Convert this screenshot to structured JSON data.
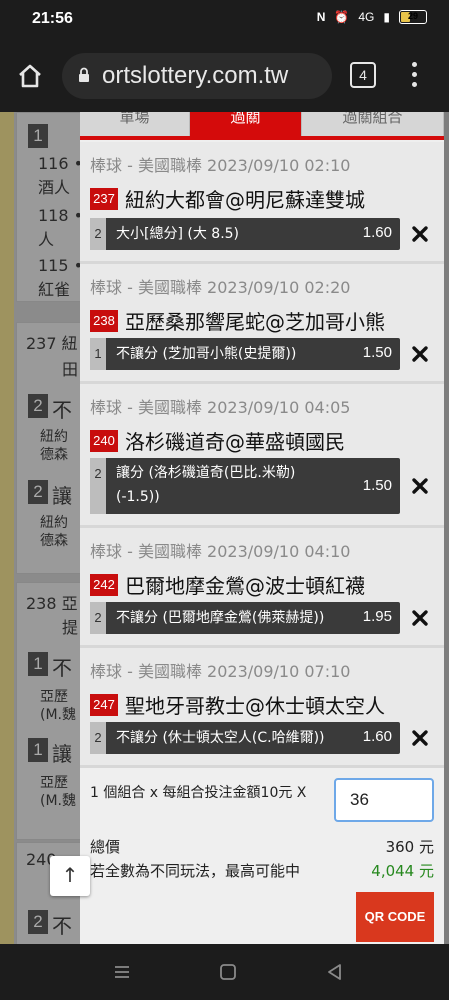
{
  "status": {
    "time": "21:56",
    "network": "4G",
    "battery": "29"
  },
  "browser": {
    "url": "ortslottery.com.tw",
    "tab_count": "4"
  },
  "slip": {
    "tabs": [
      {
        "label": "單場"
      },
      {
        "label": "過關"
      },
      {
        "label": "過關組合"
      }
    ],
    "bets": [
      {
        "league": "棒球 - 美國職棒 2023/09/10 02:10",
        "game_id": "237",
        "match": "紐約大都會@明尼蘇達雙城",
        "count": "2",
        "desc_line1": "大小[總分] (大 8.5)",
        "desc_line2": "",
        "odds": "1.60"
      },
      {
        "league": "棒球 - 美國職棒 2023/09/10 02:20",
        "game_id": "238",
        "match": "亞歷桑那響尾蛇@芝加哥小熊",
        "count": "1",
        "desc_line1": "不讓分 (芝加哥小熊(史提爾))",
        "desc_line2": "",
        "odds": "1.50"
      },
      {
        "league": "棒球 - 美國職棒 2023/09/10 04:05",
        "game_id": "240",
        "match": "洛杉磯道奇@華盛頓國民",
        "count": "2",
        "desc_line1": "讓分 (洛杉磯道奇(巴比.米勒)",
        "desc_line2": "(-1.5))",
        "odds": "1.50"
      },
      {
        "league": "棒球 - 美國職棒 2023/09/10 04:10",
        "game_id": "242",
        "match": "巴爾地摩金鶯@波士頓紅襪",
        "count": "2",
        "desc_line1": "不讓分 (巴爾地摩金鶯(佛萊赫提))",
        "desc_line2": "",
        "odds": "1.95"
      },
      {
        "league": "棒球 - 美國職棒 2023/09/10 07:10",
        "game_id": "247",
        "match": "聖地牙哥教士@休士頓太空人",
        "count": "2",
        "desc_line1": "不讓分 (休士頓太空人(C.哈維爾))",
        "desc_line2": "",
        "odds": "1.60"
      }
    ],
    "combo_text": "1 個組合 x 每組合投注金額10元 X",
    "amount_value": "36",
    "total_label": "總價",
    "total_value": "360 元",
    "maxwin_label": "若全數為不同玩法，最高可能中",
    "maxwin_value": "4,044 元",
    "qr_label": "QR CODE"
  },
  "background": {
    "num1": "1",
    "rows": [
      {
        "text": "116 •",
        "sub": "酒人"
      },
      {
        "text": "118 •",
        "sub": "人"
      },
      {
        "text": "115 •",
        "sub": "紅雀"
      }
    ],
    "game237": "237 紐",
    "g237_sub": "田",
    "game238": "238 亞",
    "g238_sub": "提",
    "game240": "240",
    "labels": [
      "不",
      "讓",
      "不",
      "讓",
      "不"
    ],
    "sub_labels": [
      "紐約",
      "德森",
      "紐約",
      "德森",
      "亞歷",
      "(M.魏",
      "亞歷",
      "(M.魏"
    ],
    "counts": [
      "2",
      "2",
      "1",
      "1",
      "2"
    ]
  },
  "up_arrow": "↑",
  "colors": {
    "accent": "#d40b0b",
    "win_green": "#26881e",
    "qr_bg": "#d9381e"
  }
}
